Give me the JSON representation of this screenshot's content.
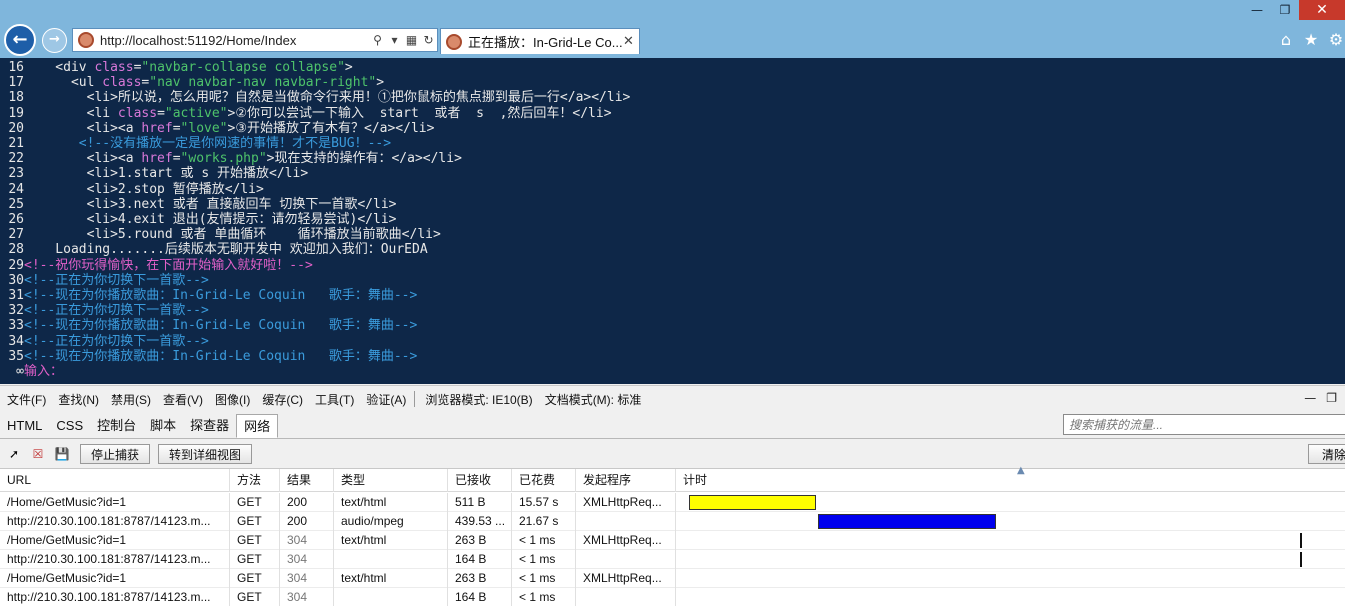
{
  "browser": {
    "url": "http://localhost:51192/Home/Index",
    "tab_title": "正在播放：In-Grid-Le Co...",
    "window_controls": [
      "minimize",
      "restore",
      "close"
    ],
    "icons": [
      "back-icon",
      "forward-icon",
      "search-icon",
      "compatibility-icon",
      "refresh-icon",
      "home-icon",
      "favorites-star-icon",
      "settings-gear-icon"
    ]
  },
  "code": {
    "lines": [
      {
        "n": "16",
        "segs": [
          [
            "t",
            "    <div "
          ],
          [
            "a",
            "class"
          ],
          [
            "t",
            "="
          ],
          [
            "s",
            "\"navbar-collapse collapse\""
          ],
          [
            "t",
            ">"
          ]
        ]
      },
      {
        "n": "17",
        "segs": [
          [
            "t",
            "      <ul "
          ],
          [
            "a",
            "class"
          ],
          [
            "t",
            "="
          ],
          [
            "s",
            "\"nav navbar-nav navbar-right\""
          ],
          [
            "t",
            ">"
          ]
        ]
      },
      {
        "n": "18",
        "segs": [
          [
            "t",
            "        <li>所以说，怎么用呢？自然是当做命令行来用！①把你鼠标的焦点挪到最后一行</a></li>"
          ]
        ]
      },
      {
        "n": "19",
        "segs": [
          [
            "t",
            "        <li "
          ],
          [
            "a",
            "class"
          ],
          [
            "t",
            "="
          ],
          [
            "s",
            "\"active\""
          ],
          [
            "t",
            ">②你可以尝试一下输入  start  或者  s  ,然后回车！</li>"
          ]
        ]
      },
      {
        "n": "20",
        "segs": [
          [
            "t",
            "        <li><a "
          ],
          [
            "a",
            "href"
          ],
          [
            "t",
            "="
          ],
          [
            "s",
            "\"love\""
          ],
          [
            "t",
            ">③开始播放了有木有？</a></li>"
          ]
        ]
      },
      {
        "n": "21",
        "segs": [
          [
            "b",
            "       <!--没有播放一定是你网速的事情！才不是BUG！-->"
          ]
        ]
      },
      {
        "n": "22",
        "segs": [
          [
            "t",
            "        <li><a "
          ],
          [
            "a",
            "href"
          ],
          [
            "t",
            "="
          ],
          [
            "s",
            "\"works.php\""
          ],
          [
            "t",
            ">现在支持的操作有：</a></li>"
          ]
        ]
      },
      {
        "n": "23",
        "segs": [
          [
            "t",
            "        <li>1.start 或 s 开始播放</li>"
          ]
        ]
      },
      {
        "n": "24",
        "segs": [
          [
            "t",
            "        <li>2.stop 暂停播放</li>"
          ]
        ]
      },
      {
        "n": "25",
        "segs": [
          [
            "t",
            "        <li>3.next 或者 直接敲回车 切换下一首歌</li>"
          ]
        ]
      },
      {
        "n": "26",
        "segs": [
          [
            "t",
            "        <li>4.exit 退出(友情提示：请勿轻易尝试)</li>"
          ]
        ]
      },
      {
        "n": "27",
        "segs": [
          [
            "t",
            "        <li>5.round 或者 单曲循环    循环播放当前歌曲</li>"
          ]
        ]
      },
      {
        "n": "28",
        "segs": [
          [
            "t",
            "    Loading.......后续版本无聊开发中 欢迎加入我们：OurEDA"
          ]
        ]
      },
      {
        "n": "29",
        "segs": [
          [
            "p",
            "<!--祝你玩得愉快，在下面开始输入就好啦！-->"
          ]
        ]
      },
      {
        "n": "30",
        "segs": [
          [
            "b",
            "<!--正在为你切换下一首歌-->"
          ]
        ]
      },
      {
        "n": "31",
        "segs": [
          [
            "b",
            "<!--现在为你播放歌曲：In-Grid-Le Coquin   歌手：舞曲-->"
          ]
        ]
      },
      {
        "n": "32",
        "segs": [
          [
            "b",
            "<!--正在为你切换下一首歌-->"
          ]
        ]
      },
      {
        "n": "33",
        "segs": [
          [
            "b",
            "<!--现在为你播放歌曲：In-Grid-Le Coquin   歌手：舞曲-->"
          ]
        ]
      },
      {
        "n": "34",
        "segs": [
          [
            "b",
            "<!--正在为你切换下一首歌-->"
          ]
        ]
      },
      {
        "n": "35",
        "segs": [
          [
            "b",
            "<!--现在为你播放歌曲：In-Grid-Le Coquin   歌手：舞曲-->"
          ]
        ]
      },
      {
        "n": "∞",
        "segs": [
          [
            "p",
            "输入："
          ]
        ]
      }
    ]
  },
  "devtools": {
    "menu": [
      "文件(F)",
      "查找(N)",
      "禁用(S)",
      "查看(V)",
      "图像(I)",
      "缓存(C)",
      "工具(T)",
      "验证(A)",
      "浏览器模式: IE10(B)",
      "文档模式(M): 标准"
    ],
    "tabs": [
      "HTML",
      "CSS",
      "控制台",
      "脚本",
      "探查器",
      "网络"
    ],
    "active_tab": "网络",
    "filter_placeholder": "搜索捕获的流量...",
    "stop_button": "停止捕获",
    "detail_button": "转到详细视图",
    "clear_button": "清除",
    "columns": [
      "URL",
      "方法",
      "结果",
      "类型",
      "已接收",
      "已花费",
      "发起程序",
      "计时"
    ],
    "rows": [
      {
        "url": "/Home/GetMusic?id=1",
        "method": "GET",
        "result": "200",
        "type": "text/html",
        "received": "511 B",
        "spent": "15.57 s",
        "initiator": "XMLHttpReq...",
        "timing": {
          "kind": "bar",
          "start": 0.02,
          "len": 0.19,
          "color": "#ffff00"
        }
      },
      {
        "url": "http://210.30.100.181:8787/14123.m...",
        "method": "GET",
        "result": "200",
        "type": "audio/mpeg",
        "received": "439.53 ...",
        "spent": "21.67 s",
        "initiator": "",
        "timing": {
          "kind": "bar",
          "start": 0.213,
          "len": 0.266,
          "color": "#0000ee"
        }
      },
      {
        "url": "/Home/GetMusic?id=1",
        "method": "GET",
        "result": "304",
        "type": "text/html",
        "received": "263 B",
        "spent": "< 1 ms",
        "initiator": "XMLHttpReq...",
        "timing": {
          "kind": "tick",
          "start": 0.933
        }
      },
      {
        "url": "http://210.30.100.181:8787/14123.m...",
        "method": "GET",
        "result": "304",
        "type": "",
        "received": "164 B",
        "spent": "< 1 ms",
        "initiator": "",
        "timing": {
          "kind": "tick",
          "start": 0.933
        }
      },
      {
        "url": "/Home/GetMusic?id=1",
        "method": "GET",
        "result": "304",
        "type": "text/html",
        "received": "263 B",
        "spent": "< 1 ms",
        "initiator": "XMLHttpReq...",
        "timing": {
          "kind": "none"
        }
      },
      {
        "url": "http://210.30.100.181:8787/14123.m...",
        "method": "GET",
        "result": "304",
        "type": "",
        "received": "164 B",
        "spent": "< 1 ms",
        "initiator": "",
        "timing": {
          "kind": "none"
        }
      }
    ]
  }
}
